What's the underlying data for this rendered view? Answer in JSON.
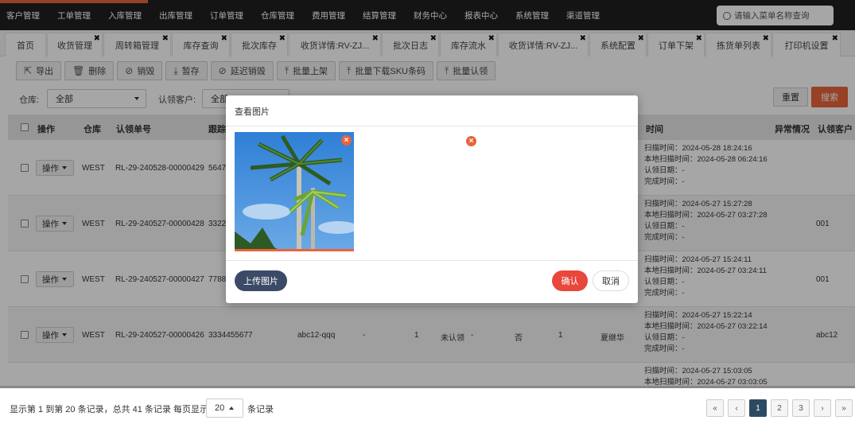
{
  "topnav": {
    "menus": [
      "客户管理",
      "工单管理",
      "入库管理",
      "出库管理",
      "订单管理",
      "仓库管理",
      "费用管理",
      "结算管理",
      "财务中心",
      "报表中心",
      "系统管理",
      "渠道管理"
    ],
    "search_placeholder": "请输入菜单名称查询"
  },
  "tabs": [
    "首页",
    "收货管理",
    "周转箱管理",
    "库存查询",
    "批次库存",
    "收货详情:RV-ZJ...",
    "批次日志",
    "库存流水",
    "收货详情:RV-ZJ...",
    "系统配置",
    "订单下架",
    "拣货单列表",
    "打印机设置"
  ],
  "toolbar": {
    "export": "导出",
    "delete": "删除",
    "destroy": "销毁",
    "hold": "暂存",
    "delay_destroy": "延迟销毁",
    "batch_shelve": "批量上架",
    "batch_download_sku": "批量下载SKU条码",
    "batch_claim": "批量认领"
  },
  "filters": {
    "warehouse_label": "仓库:",
    "warehouse_value": "全部",
    "claim_customer_label": "认领客户:",
    "claim_customer_value": "全部",
    "reset": "重置",
    "search": "搜索"
  },
  "table": {
    "headers": {
      "op": "操作",
      "warehouse": "仓库",
      "claim_no": "认领单号",
      "tracking": "跟踪",
      "time": "时间",
      "abnormal": "异常情况",
      "claim_customer": "认领客户"
    },
    "op_label": "操作",
    "rows": [
      {
        "warehouse": "WEST",
        "claim_no": "RL-29-240528-00000429",
        "tracking": "5647",
        "sku": "",
        "dash1": "",
        "qty": "",
        "status": "",
        "dash2": "",
        "flag": "",
        "num": "",
        "user": "",
        "times": [
          "扫描时间：2024-05-28 18:24:16",
          "本地扫描时间：2024-05-28 06:24:16",
          "认领日期：-",
          "完成时间：-"
        ],
        "abnormal": "",
        "customer": ""
      },
      {
        "warehouse": "WEST",
        "claim_no": "RL-29-240527-00000428",
        "tracking": "3322",
        "sku": "",
        "dash1": "",
        "qty": "",
        "status": "",
        "dash2": "",
        "flag": "",
        "num": "",
        "user": "",
        "times": [
          "扫描时间：2024-05-27 15:27:28",
          "本地扫描时间：2024-05-27 03:27:28",
          "认领日期：-",
          "完成时间：-"
        ],
        "abnormal": "",
        "customer": "001"
      },
      {
        "warehouse": "WEST",
        "claim_no": "RL-29-240527-00000427",
        "tracking": "7788",
        "sku": "",
        "dash1": "",
        "qty": "",
        "status": "",
        "dash2": "",
        "flag": "",
        "num": "",
        "user": "",
        "times": [
          "扫描时间：2024-05-27 15:24:11",
          "本地扫描时间：2024-05-27 03:24:11",
          "认领日期：-",
          "完成时间：-"
        ],
        "abnormal": "",
        "customer": "001"
      },
      {
        "warehouse": "WEST",
        "claim_no": "RL-29-240527-00000426",
        "tracking": "3334455677",
        "sku": "abc12-qqq",
        "dash1": "-",
        "qty": "1",
        "status": "未认领",
        "dash2": "-",
        "flag": "否",
        "num": "1",
        "user": "夏继华",
        "times": [
          "扫描时间：2024-05-27 15:22:14",
          "本地扫描时间：2024-05-27 03:22:14",
          "认领日期：-",
          "完成时间：-"
        ],
        "abnormal": "",
        "customer": "abc12"
      },
      {
        "warehouse": "",
        "claim_no": "",
        "tracking": "",
        "sku": "",
        "dash1": "",
        "qty": "",
        "status": "",
        "dash2": "",
        "flag": "",
        "num": "",
        "user": "",
        "times": [
          "扫描时间：2024-05-27 15:03:05",
          "本地扫描时间：2024-05-27 03:03:05",
          "",
          ""
        ],
        "abnormal": "",
        "customer": ""
      }
    ]
  },
  "modal": {
    "title": "查看图片",
    "upload": "上传图片",
    "confirm": "确认",
    "cancel": "取消"
  },
  "footer": {
    "summary": "显示第 1 到第 20 条记录，总共 41 条记录 每页显示",
    "page_size": "20",
    "suffix": "条记录",
    "pages": [
      "«",
      "‹",
      "1",
      "2",
      "3",
      "›",
      "»"
    ],
    "current_page": "1"
  }
}
